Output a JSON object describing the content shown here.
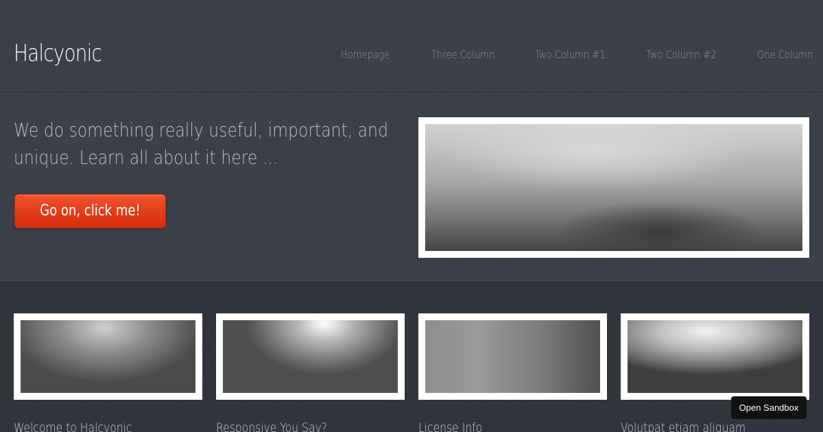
{
  "site": {
    "logo": "Halcyonic"
  },
  "nav": {
    "items": [
      {
        "label": "Homepage"
      },
      {
        "label": "Three Column"
      },
      {
        "label": "Two Column #1"
      },
      {
        "label": "Two Column #2"
      },
      {
        "label": "One Column"
      }
    ]
  },
  "hero": {
    "tagline_line1": "We do something really useful, important, and",
    "tagline_line2": "unique. Learn all about it here ...",
    "cta_label": "Go on, click me!"
  },
  "cards": [
    {
      "title": "Welcome to Halcyonic"
    },
    {
      "title": "Responsive You Say?"
    },
    {
      "title": "License Info"
    },
    {
      "title": "Volutpat etiam aliquam"
    }
  ],
  "sandbox": {
    "label": "Open Sandbox"
  },
  "colors": {
    "accent": "#e0401a",
    "background": "#30353b",
    "header": "#3a4047"
  }
}
